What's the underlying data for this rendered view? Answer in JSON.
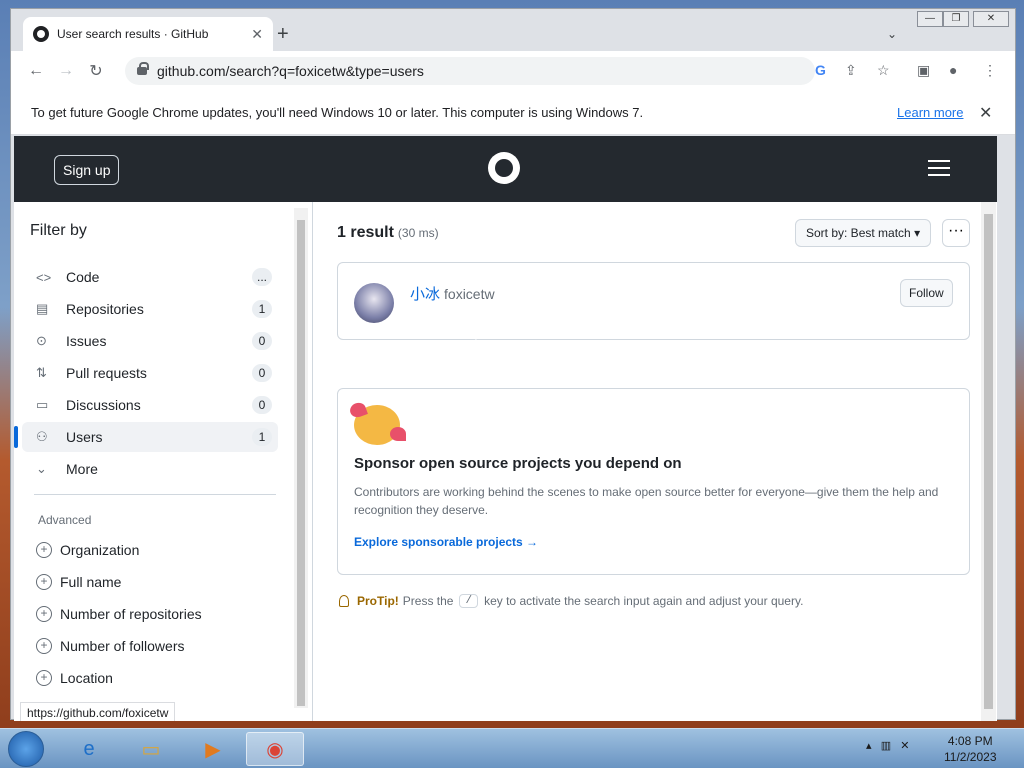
{
  "browser": {
    "tab_title": "User search results · GitHub",
    "tab_close": "✕",
    "new_tab": "+",
    "url": "github.com/search?q=foxicetw&type=users",
    "window_min": "—",
    "window_max": "❐",
    "window_close": "✕"
  },
  "infobar": {
    "message": "To get future Google Chrome updates, you'll need Windows 10 or later. This computer is using Windows 7.",
    "learn_more": "Learn more",
    "close": "✕"
  },
  "github_header": {
    "signup_label": "Sign up"
  },
  "sidebar": {
    "title": "Filter by",
    "items": [
      {
        "label": "Code",
        "count": "...",
        "icon": "code-icon"
      },
      {
        "label": "Repositories",
        "count": "1",
        "icon": "repo-icon"
      },
      {
        "label": "Issues",
        "count": "0",
        "icon": "issue-icon"
      },
      {
        "label": "Pull requests",
        "count": "0",
        "icon": "pull-request-icon"
      },
      {
        "label": "Discussions",
        "count": "0",
        "icon": "discussion-icon"
      },
      {
        "label": "Users",
        "count": "1",
        "icon": "people-icon"
      },
      {
        "label": "More",
        "count": "",
        "icon": "chevron-down-icon"
      }
    ],
    "advanced_title": "Advanced",
    "advanced": [
      {
        "label": "Organization"
      },
      {
        "label": "Full name"
      },
      {
        "label": "Number of repositories"
      },
      {
        "label": "Number of followers"
      },
      {
        "label": "Location"
      }
    ]
  },
  "results": {
    "count": "1 result",
    "time": "(30 ms)",
    "sort_label": "Sort by: Best match",
    "more": "···",
    "user": {
      "name": "小冰",
      "login": "foxicetw",
      "follow_label": "Follow"
    }
  },
  "sponsor": {
    "title": "Sponsor open source projects you depend on",
    "description": "Contributors are working behind the scenes to make open source better for everyone—give them the help and recognition they deserve.",
    "link": "Explore sponsorable projects →"
  },
  "protip": {
    "label": "ProTip!",
    "before": "Press the",
    "key": "/",
    "after": "key to activate the search input again and adjust your query."
  },
  "status_url": "https://github.com/foxicetw",
  "taskbar": {
    "time": "4:08 PM",
    "date": "11/2/2023"
  },
  "colors": {
    "accent": "#0969da",
    "header_bg": "#24292f"
  }
}
